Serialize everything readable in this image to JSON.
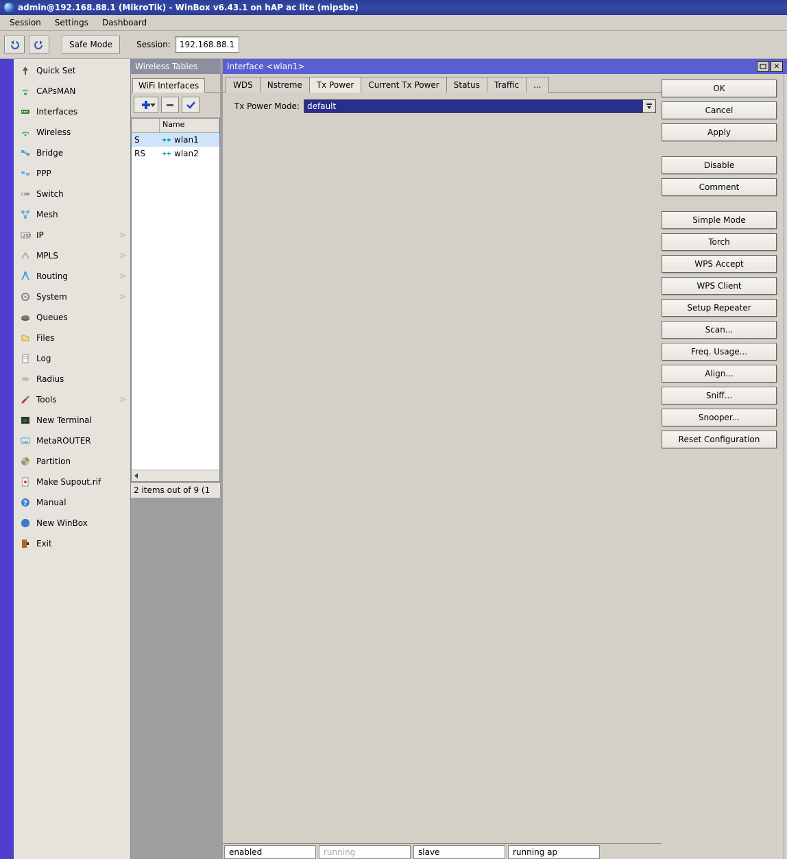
{
  "title": "admin@192.168.88.1 (MikroTik) - WinBox v6.43.1 on hAP ac lite (mipsbe)",
  "menubar": {
    "session": "Session",
    "settings": "Settings",
    "dashboard": "Dashboard"
  },
  "toolbar": {
    "safe_mode": "Safe Mode",
    "session_label": "Session:",
    "session_value": "192.168.88.1"
  },
  "sidebar": {
    "items": [
      {
        "label": "Quick Set",
        "icon": "antenna"
      },
      {
        "label": "CAPsMAN",
        "icon": "capsman"
      },
      {
        "label": "Interfaces",
        "icon": "interfaces"
      },
      {
        "label": "Wireless",
        "icon": "wireless"
      },
      {
        "label": "Bridge",
        "icon": "bridge"
      },
      {
        "label": "PPP",
        "icon": "ppp"
      },
      {
        "label": "Switch",
        "icon": "switch"
      },
      {
        "label": "Mesh",
        "icon": "mesh"
      },
      {
        "label": "IP",
        "icon": "ip",
        "sub": true
      },
      {
        "label": "MPLS",
        "icon": "mpls",
        "sub": true
      },
      {
        "label": "Routing",
        "icon": "routing",
        "sub": true
      },
      {
        "label": "System",
        "icon": "system",
        "sub": true
      },
      {
        "label": "Queues",
        "icon": "queues"
      },
      {
        "label": "Files",
        "icon": "files"
      },
      {
        "label": "Log",
        "icon": "log"
      },
      {
        "label": "Radius",
        "icon": "radius"
      },
      {
        "label": "Tools",
        "icon": "tools",
        "sub": true
      },
      {
        "label": "New Terminal",
        "icon": "terminal"
      },
      {
        "label": "MetaROUTER",
        "icon": "metarouter"
      },
      {
        "label": "Partition",
        "icon": "partition"
      },
      {
        "label": "Make Supout.rif",
        "icon": "supout"
      },
      {
        "label": "Manual",
        "icon": "manual"
      },
      {
        "label": "New WinBox",
        "icon": "newwinbox"
      },
      {
        "label": "Exit",
        "icon": "exit"
      }
    ]
  },
  "wireless_tables": {
    "title": "Wireless Tables",
    "tab": "WiFi Interfaces",
    "col_flags_header": "",
    "col_name_header": "Name",
    "rows": [
      {
        "flags": "S",
        "name": "wlan1",
        "selected": true
      },
      {
        "flags": "RS",
        "name": "wlan2",
        "selected": false
      }
    ],
    "status": "2 items out of 9 (1"
  },
  "interface_window": {
    "title": "Interface <wlan1>",
    "tabs": [
      "WDS",
      "Nstreme",
      "Tx Power",
      "Current Tx Power",
      "Status",
      "Traffic",
      "..."
    ],
    "active_tab": 2,
    "tx_power_mode_label": "Tx Power Mode:",
    "tx_power_mode_value": "default",
    "buttons": {
      "ok": "OK",
      "cancel": "Cancel",
      "apply": "Apply",
      "disable": "Disable",
      "comment": "Comment",
      "simple_mode": "Simple Mode",
      "torch": "Torch",
      "wps_accept": "WPS Accept",
      "wps_client": "WPS Client",
      "setup_repeater": "Setup Repeater",
      "scan": "Scan...",
      "freq_usage": "Freq. Usage...",
      "align": "Align...",
      "sniff": "Sniff...",
      "snooper": "Snooper...",
      "reset": "Reset Configuration"
    },
    "status_strip": {
      "enabled": "enabled",
      "running": "running",
      "slave": "slave",
      "running_ap": "running ap"
    }
  }
}
